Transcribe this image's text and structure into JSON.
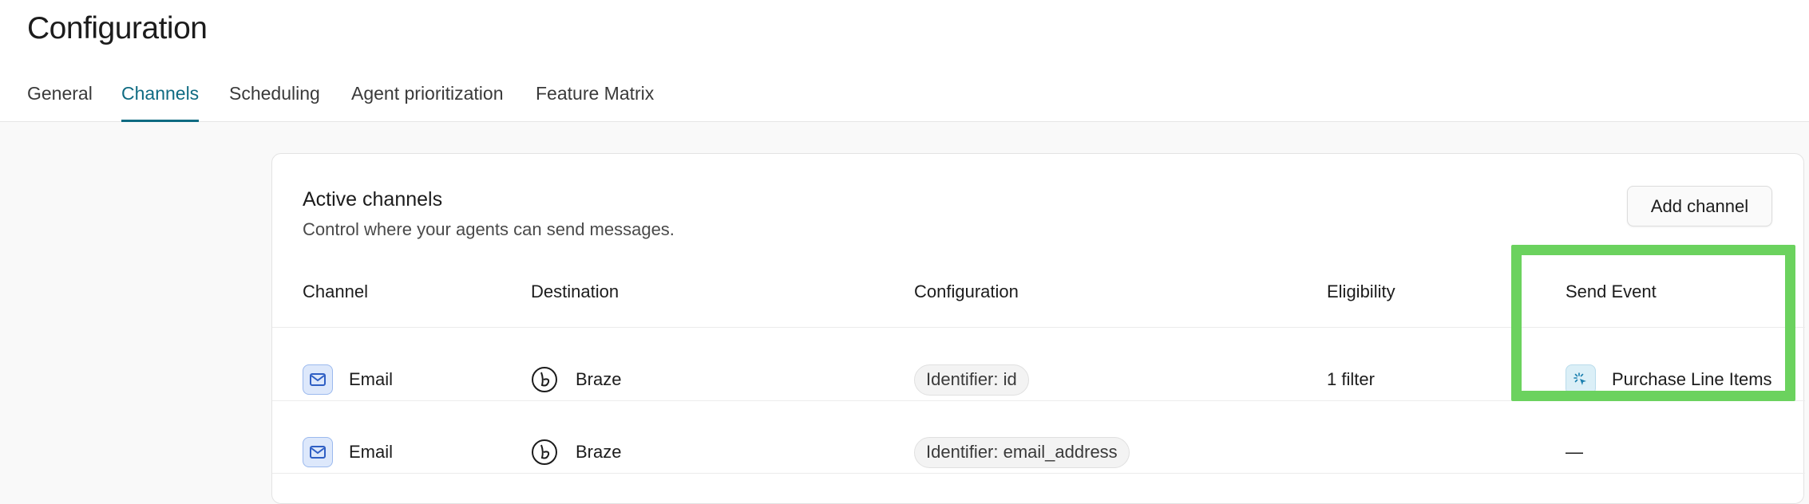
{
  "page": {
    "title": "Configuration"
  },
  "tabs": [
    {
      "label": "General",
      "active": false
    },
    {
      "label": "Channels",
      "active": true
    },
    {
      "label": "Scheduling",
      "active": false
    },
    {
      "label": "Agent prioritization",
      "active": false
    },
    {
      "label": "Feature Matrix",
      "active": false
    }
  ],
  "colors": {
    "accent": "#0f6b82",
    "highlight": "#6bd25e"
  },
  "panel": {
    "title": "Active channels",
    "subtitle": "Control where your agents can send messages.",
    "add_button_label": "Add channel"
  },
  "table": {
    "columns": [
      "Channel",
      "Destination",
      "Configuration",
      "Eligibility",
      "Send Event"
    ],
    "rows": [
      {
        "channel": "Email",
        "channel_icon": "mail-icon",
        "destination": "Braze",
        "destination_icon": "braze-icon",
        "configuration": "Identifier: id",
        "eligibility": "1 filter",
        "send_event": "Purchase Line Items",
        "send_event_icon": "click-icon"
      },
      {
        "channel": "Email",
        "channel_icon": "mail-icon",
        "destination": "Braze",
        "destination_icon": "braze-icon",
        "configuration": "Identifier: email_address",
        "eligibility": "",
        "send_event": "—"
      }
    ]
  }
}
